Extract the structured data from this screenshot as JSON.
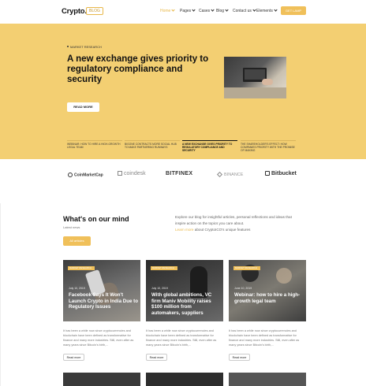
{
  "header": {
    "logo": "Crypto.",
    "logo_badge": "BLOG",
    "nav": [
      {
        "label": "Home",
        "active": true
      },
      {
        "label": "Pages",
        "active": false
      },
      {
        "label": "Cases",
        "active": false
      },
      {
        "label": "Blog",
        "active": false
      },
      {
        "label": "Contact us",
        "active": false
      },
      {
        "label": "Elements",
        "active": false
      }
    ],
    "cta": "GET LAMP"
  },
  "hero": {
    "tag": "MARKET RESEARCH",
    "title": "A new exchange gives priority to regulatory compliance and security",
    "button": "READ MORE",
    "slides": [
      {
        "text": "WEBINAR: HOW TO HIRE A HIGH-GROWTH LEGAL TEAM",
        "active": false
      },
      {
        "text": "BIGONE CONTRACTS MORE SOCIAL HUB TO MAKE PARTNERING RUNWAYS",
        "active": false
      },
      {
        "text": "A NEW EXCHANGE GIVES PRIORITY TO REGULATORY COMPLIANCE AND SECURITY",
        "active": true
      },
      {
        "text": "THE SHAREHOLDER'S EFFECT: HOW COMPANIES PRIORITY WITH THE PROMISE OF MAKING",
        "active": false
      }
    ]
  },
  "partners": [
    "CoinMarketCap",
    "coindesk",
    "BITFINEX",
    "BINANCE",
    "Bitbucket"
  ],
  "section": {
    "title": "What's on our mind",
    "subtitle": "Latest news",
    "button": "All articles",
    "description": "Explore our blog for insightful articles, personal reflections and ideas that inspire action on the topics you care about.",
    "link_text": "Learn more",
    "link_tail": " about CryptoICO's unique features"
  },
  "cards": [
    {
      "badge": "MARKET RESEARCH",
      "date": "July 10, 2019",
      "title": "Facebook Says It Won't Launch Crypto in India Due to Regulatory Issues",
      "text": "It has been a while now since cryptocurrencies and blockchain have been defined as transformative for finance and many more industries. Still, even after as many years since Bitcoin's birth,...",
      "button": "Read more"
    },
    {
      "badge": "MARKET RESEARCH",
      "date": "July 10, 2019",
      "title": "With global ambitions, VC firm Maniv Mobility raises $100 million from automakers, suppliers",
      "text": "It has been a while now since cryptocurrencies and blockchain have been defined as transformative for finance and many more industries. Still, even after as many years since Bitcoin's birth,...",
      "button": "Read more"
    },
    {
      "badge": "MARKET RESEARCH",
      "date": "June 10, 2019",
      "title": "Webinar: how to hire a high-growth legal team",
      "text": "It has been a while now since cryptocurrencies and blockchain have been defined as transformative for finance and many more industries. Still, even after as many years since Bitcoin's birth,...",
      "button": "Read more"
    }
  ],
  "colors": {
    "accent": "#f0c05a",
    "hero_bg": "#f3cf72"
  }
}
